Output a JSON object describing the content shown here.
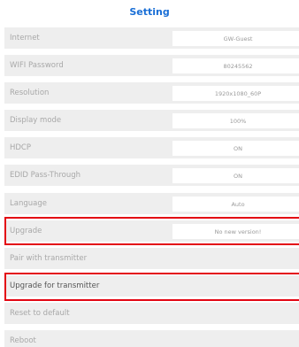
{
  "header": {
    "title": "Setting"
  },
  "settings": [
    {
      "label": "Internet",
      "value": "GW-Guest"
    },
    {
      "label": "WIFI Password",
      "value": "80245562"
    },
    {
      "label": "Resolution",
      "value": "1920x1080_60P"
    },
    {
      "label": "Display mode",
      "value": "100%"
    },
    {
      "label": "HDCP",
      "value": "ON"
    },
    {
      "label": "EDID Pass-Through",
      "value": "ON"
    },
    {
      "label": "Language",
      "value": "Auto"
    },
    {
      "label": "Upgrade",
      "value": "No new version!"
    },
    {
      "label": "Pair with transmitter"
    },
    {
      "label": "Upgrade for transmitter"
    },
    {
      "label": "Reset to default"
    },
    {
      "label": "Reboot"
    }
  ],
  "colors": {
    "title": "#1a6fd6",
    "highlight": "#e30613",
    "row_bg": "#eeeeee"
  }
}
